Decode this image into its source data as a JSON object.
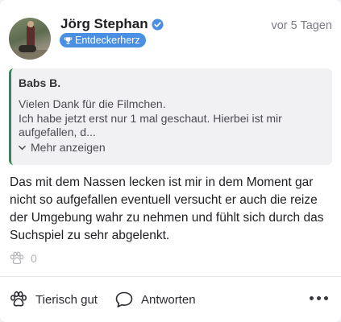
{
  "post": {
    "author": "Jörg Stephan",
    "badge": "Entdeckerherz",
    "timestamp": "vor 5 Tagen",
    "text": "Das mit dem Nassen lecken ist mir in dem Moment gar nicht so aufgefallen eventuell versucht er auch die reize der Umgebung wahr zu nehmen und fühlt sich durch das Suchspiel zu sehr abgelenkt."
  },
  "quote": {
    "author": "Babs B.",
    "text": "Vielen Dank für die Filmchen.\nIch habe jetzt erst nur 1 mal geschaut. Hierbei ist mir aufgefallen, d...",
    "more_label": "Mehr anzeigen"
  },
  "reactions": {
    "count": "0"
  },
  "actions": {
    "like_label": "Tierisch gut",
    "reply_label": "Antworten"
  },
  "icons": {
    "verified": "verified-check-icon",
    "badge": "trophy-icon",
    "reaction": "paw-icon",
    "reply": "speech-bubble-icon",
    "more": "more-dots-icon"
  },
  "colors": {
    "accent": "#4a90e2",
    "quote_border": "#2e8b57"
  }
}
